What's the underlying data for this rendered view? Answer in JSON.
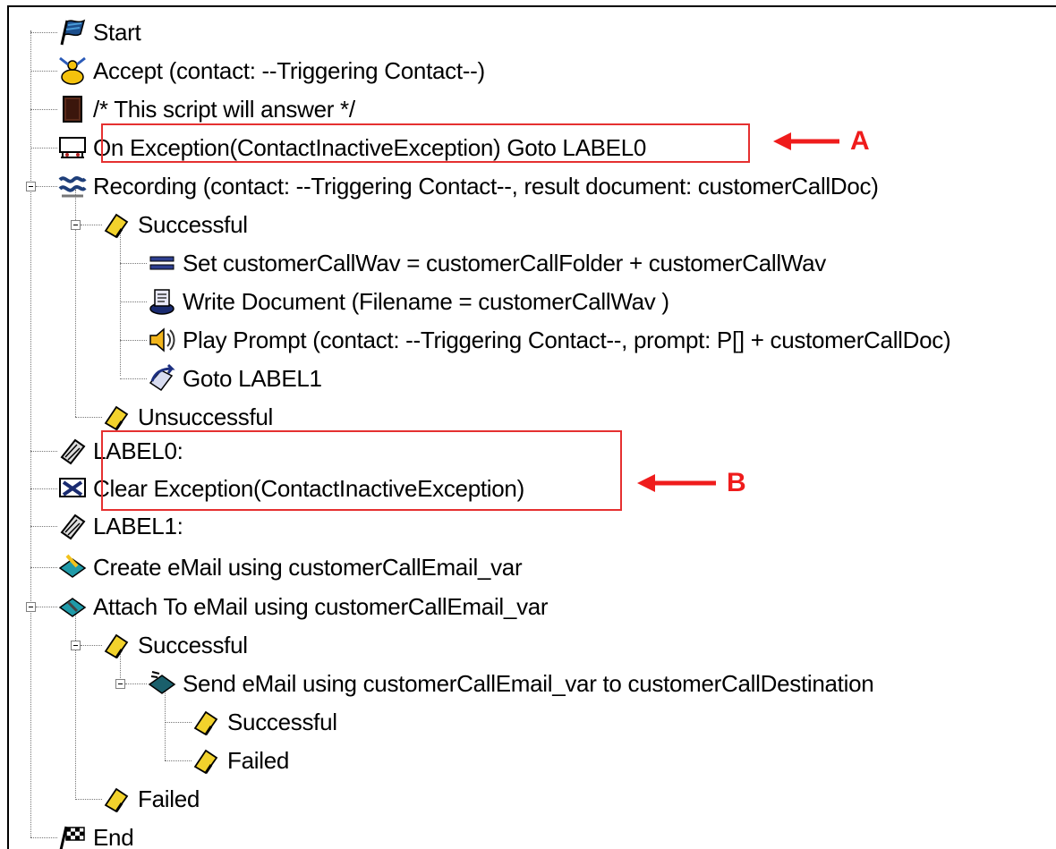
{
  "header": {
    "title": ""
  },
  "tree": [
    {
      "id": "start",
      "label": "Start",
      "icon": "start-flag-icon"
    },
    {
      "id": "accept",
      "label": "Accept (contact: --Triggering Contact--)",
      "icon": "accept-contact-icon"
    },
    {
      "id": "comment",
      "label": "/* This script will answer     */",
      "icon": "comment-document-icon"
    },
    {
      "id": "on-exception",
      "label": "On Exception(ContactInactiveException) Goto LABEL0",
      "icon": "on-exception-icon"
    },
    {
      "id": "recording",
      "label": "Recording (contact: --Triggering Contact--, result document: customerCallDoc)",
      "icon": "recording-icon"
    },
    {
      "id": "rec-successful",
      "label": "Successful",
      "icon": "branch-tag-icon"
    },
    {
      "id": "set-var",
      "label": "Set customerCallWav = customerCallFolder +  customerCallWav",
      "icon": "set-variable-icon"
    },
    {
      "id": "write-doc",
      "label": "Write Document (Filename = customerCallWav )",
      "icon": "write-document-icon"
    },
    {
      "id": "play-prompt",
      "label": "Play Prompt (contact: --Triggering Contact--, prompt: P[] + customerCallDoc)",
      "icon": "play-prompt-icon"
    },
    {
      "id": "goto-label1",
      "label": "Goto LABEL1",
      "icon": "goto-icon"
    },
    {
      "id": "rec-unsuccessful",
      "label": "Unsuccessful",
      "icon": "branch-tag-icon"
    },
    {
      "id": "label0",
      "label": "LABEL0:",
      "icon": "label-tag-icon"
    },
    {
      "id": "clear-exception",
      "label": "Clear Exception(ContactInactiveException)",
      "icon": "clear-exception-icon"
    },
    {
      "id": "label1",
      "label": "LABEL1:",
      "icon": "label-tag-icon"
    },
    {
      "id": "create-email",
      "label": "Create eMail using customerCallEmail_var",
      "icon": "create-email-icon"
    },
    {
      "id": "attach-email",
      "label": "Attach To eMail using customerCallEmail_var",
      "icon": "attach-email-icon"
    },
    {
      "id": "attach-successful",
      "label": "Successful",
      "icon": "branch-tag-icon"
    },
    {
      "id": "send-email",
      "label": "Send eMail using customerCallEmail_var to customerCallDestination",
      "icon": "send-email-icon"
    },
    {
      "id": "send-successful",
      "label": "Successful",
      "icon": "branch-tag-icon"
    },
    {
      "id": "send-failed",
      "label": "Failed",
      "icon": "branch-tag-icon"
    },
    {
      "id": "attach-failed",
      "label": "Failed",
      "icon": "branch-tag-icon"
    },
    {
      "id": "end",
      "label": "End",
      "icon": "end-flag-icon"
    }
  ],
  "callouts": {
    "a": "A",
    "b": "B"
  },
  "colors": {
    "highlight": "#e53030",
    "callout": "#ef1c1c"
  }
}
